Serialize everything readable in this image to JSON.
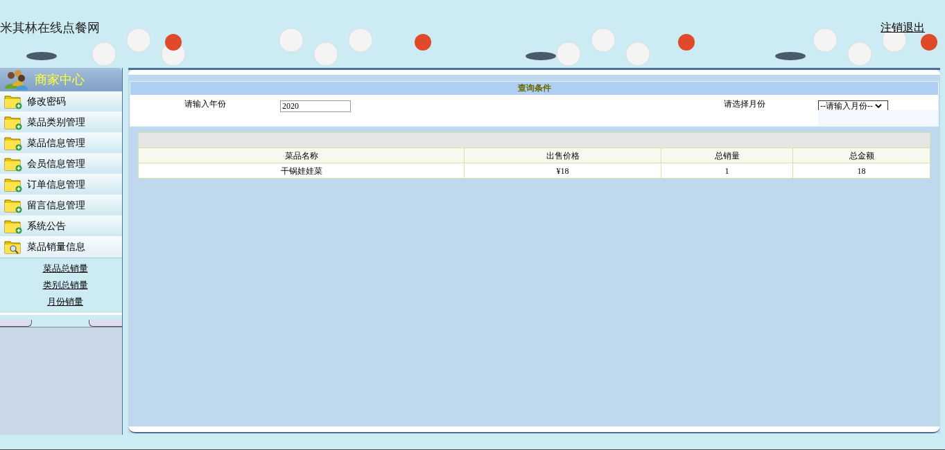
{
  "header": {
    "site_title": "米其林在线点餐网",
    "logout_link": "注销退出"
  },
  "sidebar": {
    "title": "商家中心",
    "items": [
      {
        "label": "修改密码",
        "kind": "folder",
        "expanded": false
      },
      {
        "label": "菜品类别管理",
        "kind": "folder",
        "expanded": false
      },
      {
        "label": "菜品信息管理",
        "kind": "folder",
        "expanded": false
      },
      {
        "label": "会员信息管理",
        "kind": "folder",
        "expanded": false
      },
      {
        "label": "订单信息管理",
        "kind": "folder",
        "expanded": false
      },
      {
        "label": "留言信息管理",
        "kind": "folder",
        "expanded": false
      },
      {
        "label": "系统公告",
        "kind": "folder",
        "expanded": false
      },
      {
        "label": "菜品销量信息",
        "kind": "search",
        "expanded": true,
        "children": [
          {
            "label": "菜品总销量"
          },
          {
            "label": "类别总销量"
          },
          {
            "label": "月份销量"
          }
        ]
      }
    ]
  },
  "query": {
    "title": "查询条件",
    "year_label": "请输入年份",
    "year_value": "2020",
    "month_label": "请选择月份",
    "month_value": "--请输入月份--"
  },
  "table": {
    "columns": [
      "菜品名称",
      "出售价格",
      "总销量",
      "总金额"
    ],
    "rows": [
      [
        "干锅娃娃菜",
        "¥18",
        "1",
        "18"
      ]
    ]
  }
}
